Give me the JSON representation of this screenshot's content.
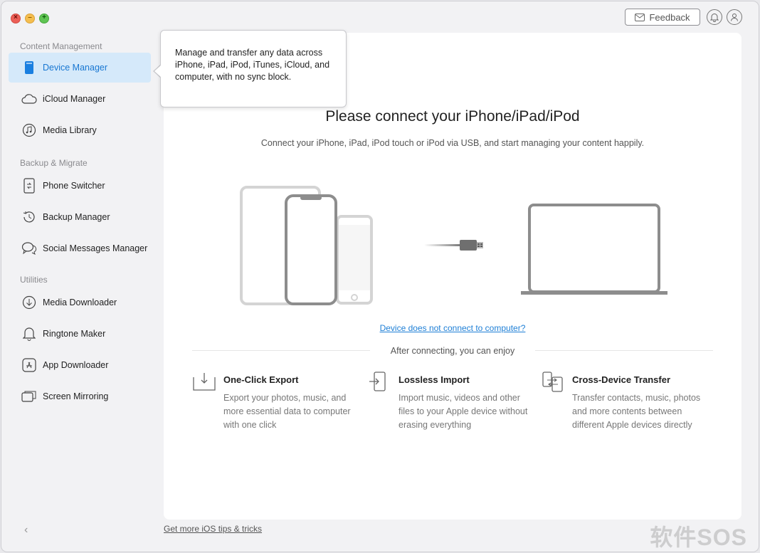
{
  "window": {
    "close_glyph": "×",
    "min_glyph": "–",
    "max_glyph": "+"
  },
  "header": {
    "feedback_label": "Feedback",
    "notifications_icon": "bell-icon",
    "account_icon": "user-icon"
  },
  "sidebar": {
    "sections": [
      {
        "title": "Content Management"
      },
      {
        "title": "Backup & Migrate"
      },
      {
        "title": "Utilities"
      }
    ],
    "items": [
      {
        "label": "Device Manager",
        "icon": "device-icon",
        "active": true
      },
      {
        "label": "iCloud Manager",
        "icon": "cloud-icon"
      },
      {
        "label": "Media Library",
        "icon": "music-icon"
      },
      {
        "label": "Phone Switcher",
        "icon": "phone-switch-icon"
      },
      {
        "label": "Backup Manager",
        "icon": "history-icon"
      },
      {
        "label": "Social Messages Manager",
        "icon": "chat-icon"
      },
      {
        "label": "Media Downloader",
        "icon": "download-icon"
      },
      {
        "label": "Ringtone Maker",
        "icon": "bell-icon"
      },
      {
        "label": "App Downloader",
        "icon": "app-store-icon"
      },
      {
        "label": "Screen Mirroring",
        "icon": "mirror-icon"
      }
    ],
    "collapse_glyph": "‹"
  },
  "tooltip": {
    "text": "Manage and transfer any data across iPhone, iPad, iPod, iTunes, iCloud, and computer, with no sync block."
  },
  "main": {
    "headline": "Please connect your iPhone/iPad/iPod",
    "subline": "Connect your iPhone, iPad, iPod touch or iPod via USB, and start managing your content happily.",
    "help_link": "Device does not connect to computer?",
    "after_label": "After connecting, you can enjoy",
    "features": [
      {
        "title": "One-Click Export",
        "desc": "Export your photos, music, and more essential data to computer with one click",
        "icon": "export-icon"
      },
      {
        "title": "Lossless Import",
        "desc": "Import music, videos and other files to your Apple device without erasing everything",
        "icon": "import-icon"
      },
      {
        "title": "Cross-Device Transfer",
        "desc": "Transfer contacts, music, photos and more contents between different Apple devices directly",
        "icon": "transfer-icon"
      }
    ]
  },
  "footer": {
    "tips_link": "Get more iOS tips & tricks"
  },
  "watermark": {
    "text": "软件SOS"
  },
  "colors": {
    "accent": "#1877d2",
    "active_bg": "#d5e9fa",
    "link": "#1e7fd6"
  }
}
